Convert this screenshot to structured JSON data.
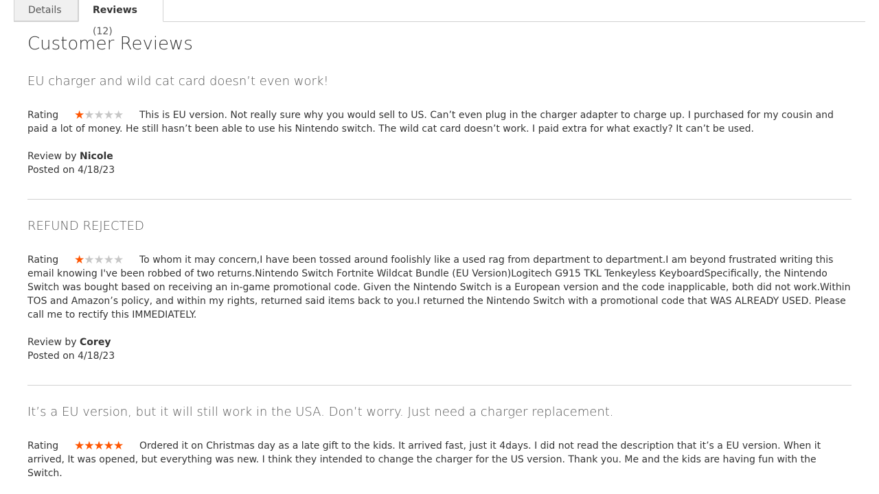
{
  "tabs": {
    "details_label": "Details",
    "reviews_label": "Reviews",
    "reviews_count": "(12)"
  },
  "page_title": "Customer Reviews",
  "rating_label": "Rating",
  "review_by_prefix": "Review by",
  "posted_on_prefix": "Posted on",
  "colors": {
    "star_on": "#ff5501",
    "star_off": "#c7c7c7"
  },
  "reviews": [
    {
      "title": "EU charger and wild cat card doesn’t even work!",
      "stars": 1,
      "text": "This is EU version. Not really sure why you would sell to US. Can’t even plug in the charger adapter to charge up. I purchased for my cousin and paid a lot of money. He still hasn’t been able to use his Nintendo switch. The wild cat card doesn’t work. I paid extra for what exactly? It can’t be used.",
      "author": "Nicole",
      "date": "4/18/23"
    },
    {
      "title": "REFUND REJECTED",
      "stars": 1,
      "text": "To whom it may concern,I have been tossed around foolishly like a used rag from department to department.I am beyond frustrated writing this email knowing I've been robbed of two returns.Nintendo Switch Fortnite Wildcat Bundle (EU Version)Logitech G915 TKL Tenkeyless KeyboardSpecifically, the Nintendo Switch was bought based on receiving an in-game promotional code. Given the Nintendo Switch is a European version and the code inapplicable, both did not work.Within TOS and Amazon’s policy, and within my rights, returned said items back to you.I returned the Nintendo Switch with a promotional code that WAS ALREADY USED. Please call me to rectify this IMMEDIATELY.",
      "author": "Corey",
      "date": "4/18/23"
    },
    {
      "title": "It’s a EU version, but it will still work in the USA. Don’t worry. Just need a charger replacement.",
      "stars": 5,
      "text": "Ordered it on Christmas day as a late gift to the kids. It arrived fast, just it 4days. I did not read the description that it’s a EU version. When it arrived, It was opened, but everything was new. I think they intended to change the charger for the US version. Thank you. Me and the kids are having fun with the Switch.",
      "author": "",
      "date": ""
    }
  ]
}
